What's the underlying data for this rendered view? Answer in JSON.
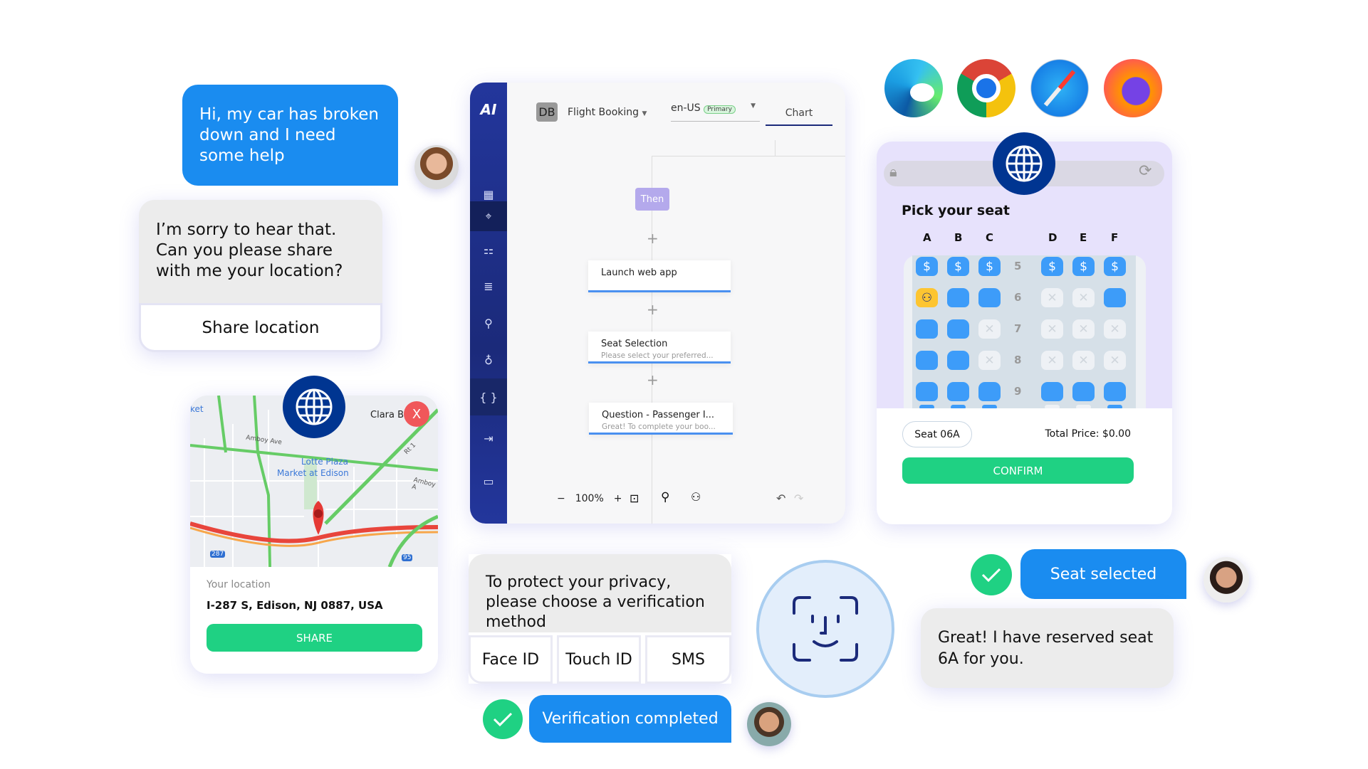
{
  "chat": {
    "user_message": "Hi, my car has broken down and I need some help",
    "bot_message": "I’m sorry to hear that. Can you please share with me your location?",
    "share_location_label": "Share location"
  },
  "map_card": {
    "map_labels": [
      "Clara B",
      "Amboy Ave",
      "Lotte Plaza",
      "Market at Edison",
      "Amboy A",
      "Rt 1",
      "287",
      "95",
      "ket"
    ],
    "location_label": "Your location",
    "address": "I-287 S, Edison, NJ 0887, USA",
    "share_label": "SHARE",
    "close_label": "X"
  },
  "flow_editor": {
    "logo": "AI",
    "badge": "DB",
    "project": "Flight Booking",
    "locale": "en-US",
    "locale_tag": "Primary",
    "tab": "Chart",
    "then_label": "Then",
    "nodes": [
      {
        "title": "Launch web app",
        "subtitle": ""
      },
      {
        "title": "Seat Selection",
        "subtitle": "Please select your preferred..."
      },
      {
        "title": "Question - Passenger I...",
        "subtitle": "Great! To complete your boo..."
      }
    ],
    "zoom": "100%",
    "sidebar_icons": [
      "grid-icon",
      "pin-tool-icon",
      "hierarchy-icon",
      "list-icon",
      "plug-icon",
      "lightbulb-icon",
      "braces-icon",
      "logout-icon",
      "chat-icon"
    ]
  },
  "browsers": [
    "edge",
    "chrome",
    "safari",
    "firefox"
  ],
  "seat_picker": {
    "title": "Pick your seat",
    "columns": [
      "A",
      "B",
      "C",
      "D",
      "E",
      "F"
    ],
    "rows": [
      {
        "number": "5",
        "seats": [
          "paid",
          "paid",
          "paid",
          "paid",
          "paid",
          "paid"
        ]
      },
      {
        "number": "6",
        "seats": [
          "selected",
          "available",
          "available",
          "taken",
          "taken",
          "available"
        ]
      },
      {
        "number": "7",
        "seats": [
          "available",
          "available",
          "taken",
          "taken",
          "taken",
          "taken"
        ]
      },
      {
        "number": "8",
        "seats": [
          "available",
          "available",
          "taken",
          "taken",
          "taken",
          "taken"
        ]
      },
      {
        "number": "9",
        "seats": [
          "available",
          "available",
          "available",
          "available",
          "available",
          "available"
        ]
      }
    ],
    "seat_label": "Seat 06A",
    "total_price": "Total Price: $0.00",
    "confirm_label": "CONFIRM",
    "colors": {
      "available": "#3d9cf9",
      "selected": "#fdc531",
      "taken": "#eef1f5",
      "confirm": "#1fd183"
    }
  },
  "verification": {
    "prompt": "To protect your privacy, please choose a verification method",
    "options": [
      "Face ID",
      "Touch ID",
      "SMS"
    ],
    "completed": "Verification completed"
  },
  "seat_chat": {
    "user_message": "Seat selected",
    "bot_message": "Great! I have reserved seat 6A for you."
  }
}
